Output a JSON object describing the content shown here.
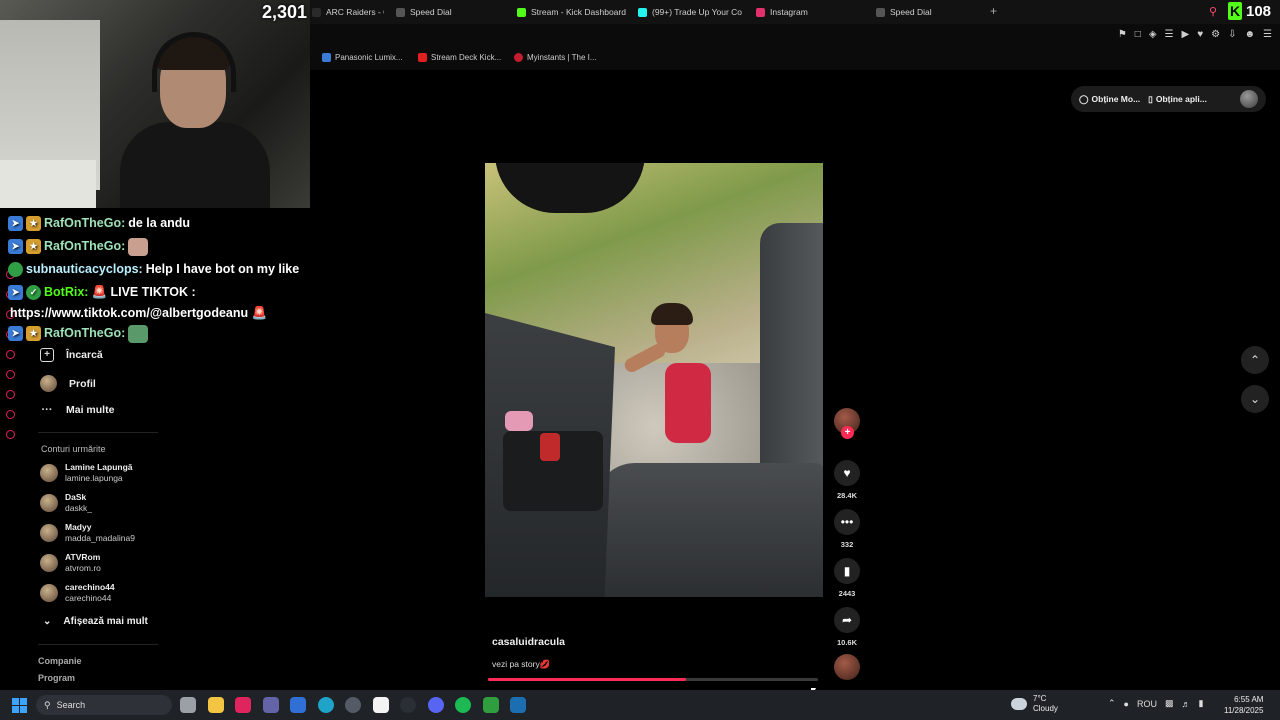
{
  "browser": {
    "tabs": [
      {
        "label": "ARC Raiders - Offi",
        "color": "#2a2a2a"
      },
      {
        "label": "Speed Dial",
        "color": "#555"
      },
      {
        "label": "Stream - Kick Dashboard",
        "color": "#53fc18"
      },
      {
        "label": "(99+) Trade Up Your Cov",
        "color": "#25f4ee"
      },
      {
        "label": "Instagram",
        "color": "#e1306c"
      },
      {
        "label": "Speed Dial",
        "color": "#555"
      }
    ],
    "new_tab": "+",
    "bookmarks": [
      {
        "label": "Panasonic Lumix...",
        "color": "#3b7bd6"
      },
      {
        "label": "Stream Deck Kick...",
        "color": "#e02020"
      },
      {
        "label": "Myinstants | The I...",
        "color": "#c41d2f"
      }
    ]
  },
  "stream_overlay": {
    "viewer_count": "2,301",
    "kick_viewers": "108",
    "kick_logo": "K"
  },
  "chat": [
    {
      "user": "RafOnTheGo:",
      "message": "de la andu",
      "user_color": "#9ee2b8"
    },
    {
      "user": "RafOnTheGo:",
      "message": "",
      "emote_color": "#c9a090",
      "user_color": "#9ee2b8"
    },
    {
      "user": "subnauticacyclops:",
      "message": "Help I have bot on my like",
      "user_color": "#9ee2b8"
    },
    {
      "user": "BotRix:",
      "message": "🚨 LIVE TIKTOK :",
      "user_color": "#53fc18"
    },
    {
      "user": "",
      "message": "https://www.tiktok.com/@albertgodeanu 🚨"
    },
    {
      "user": "RafOnTheGo:",
      "message": "",
      "emote_color": "#5a9a6a",
      "user_color": "#9ee2b8"
    }
  ],
  "sidebar": {
    "nav": [
      {
        "label": "Încarcă",
        "icon": "upload-icon"
      },
      {
        "label": "Profil",
        "icon": "avatar"
      },
      {
        "label": "Mai multe",
        "icon": "more-icon"
      }
    ],
    "following_title": "Conturi urmărite",
    "following": [
      {
        "name": "Lamine Lapungă",
        "handle": "lamine.lapunga"
      },
      {
        "name": "DaSk",
        "handle": "daskk_"
      },
      {
        "name": "Madyy",
        "handle": "madda_madalina9"
      },
      {
        "name": "ATVRom",
        "handle": "atvrom.ro"
      },
      {
        "name": "carechino44",
        "handle": "carechino44"
      }
    ],
    "show_more": "Afișează mai mult",
    "footer": [
      "Companie",
      "Program"
    ]
  },
  "top_right": {
    "get_coins": "Obține Mo...",
    "get_app": "Obține apli..."
  },
  "video": {
    "username": "casaluidracula",
    "caption": "vezi pa story💋",
    "progress": 0.6,
    "likes": "28.4K",
    "comments": "332",
    "saves": "2443",
    "shares": "10.6K"
  },
  "taskbar": {
    "search_label": "Search",
    "weather_temp": "7°C",
    "weather_desc": "Cloudy",
    "language": "ROU",
    "time": "6:55 AM",
    "date": "11/28/2025",
    "apps": [
      {
        "name": "taskview-icon",
        "color": "#9aa0a6"
      },
      {
        "name": "file-explorer-icon",
        "color": "#f4c542"
      },
      {
        "name": "opera-icon",
        "color": "#e0245e"
      },
      {
        "name": "teams-icon",
        "color": "#6264a7"
      },
      {
        "name": "app-blue-icon",
        "color": "#2f6fd6"
      },
      {
        "name": "edge-icon",
        "color": "#1fa3c8"
      },
      {
        "name": "steam-dark-icon",
        "color": "#555b66"
      },
      {
        "name": "store-icon",
        "color": "#f3f3f3"
      },
      {
        "name": "clock-app-icon",
        "color": "#2a2e35"
      },
      {
        "name": "discord-icon",
        "color": "#5865f2"
      },
      {
        "name": "spotify-icon",
        "color": "#1db954"
      },
      {
        "name": "xbox-icon",
        "color": "#2e9e3e"
      },
      {
        "name": "steam-icon",
        "color": "#1b6fb0"
      }
    ]
  }
}
